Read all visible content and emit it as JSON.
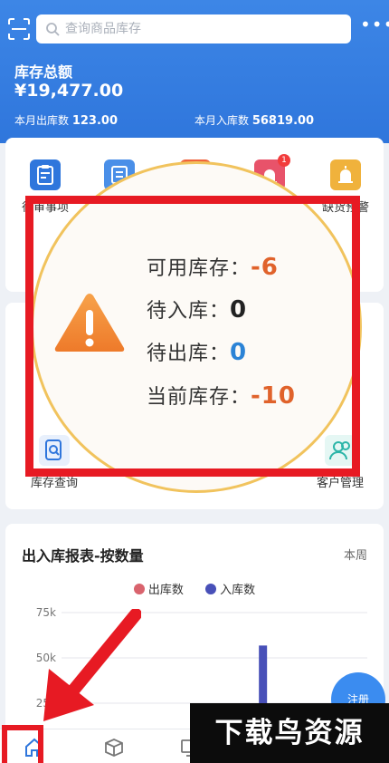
{
  "search": {
    "placeholder": "查询商品库存"
  },
  "header": {
    "more_label": "•••",
    "stock_title": "库存总额",
    "stock_amount": "¥19,477.00",
    "month_out_label": "本月出库数",
    "month_out_value": "123.00",
    "month_in_label": "本月入库数",
    "month_in_value": "56819.00"
  },
  "features": [
    {
      "label": "待审事项",
      "icon": "clipboard-check-icon",
      "color": "#2f76dc"
    },
    {
      "label": "",
      "icon": "document-icon",
      "color": "#4a8fe8"
    },
    {
      "label": "",
      "icon": "store-icon",
      "color": "#f0643c"
    },
    {
      "label": "",
      "icon": "alarm-icon",
      "color": "#f0643c",
      "badge": "1"
    },
    {
      "label": "缺货预警",
      "icon": "alarm-icon",
      "color": "#f0b23c"
    }
  ],
  "grid": [
    {
      "label": "库存查询",
      "icon": "inventory-search-icon",
      "color": "#2f76dc"
    },
    {
      "label": "客户管理",
      "icon": "customers-icon",
      "color": "#2bb5a8"
    }
  ],
  "popup": {
    "available_label": "可用库存：",
    "available_value": "-6",
    "pending_in_label": "待入库：",
    "pending_in_value": "0",
    "pending_out_label": "待出库：",
    "pending_out_value": "0",
    "current_label": "当前库存：",
    "current_value": "-10"
  },
  "fab": {
    "label": "注册"
  },
  "watermark": {
    "text": "下载鸟资源"
  },
  "colors": {
    "accent": "#2f76dc",
    "out_series": "#d9636d",
    "in_series": "#4850b8",
    "annotation": "#e71a23"
  },
  "chart_data": {
    "type": "bar",
    "title": "出入库报表-按数量",
    "period": "本周",
    "series": [
      {
        "name": "出库数",
        "values": [
          0,
          0
        ]
      },
      {
        "name": "入库数",
        "values": [
          0,
          56819
        ]
      }
    ],
    "categories": [
      "",
      ""
    ],
    "y_ticks": [
      "75k",
      "50k",
      "25k"
    ],
    "ylim": [
      0,
      75000
    ],
    "grid": true,
    "legend": "top-center"
  }
}
